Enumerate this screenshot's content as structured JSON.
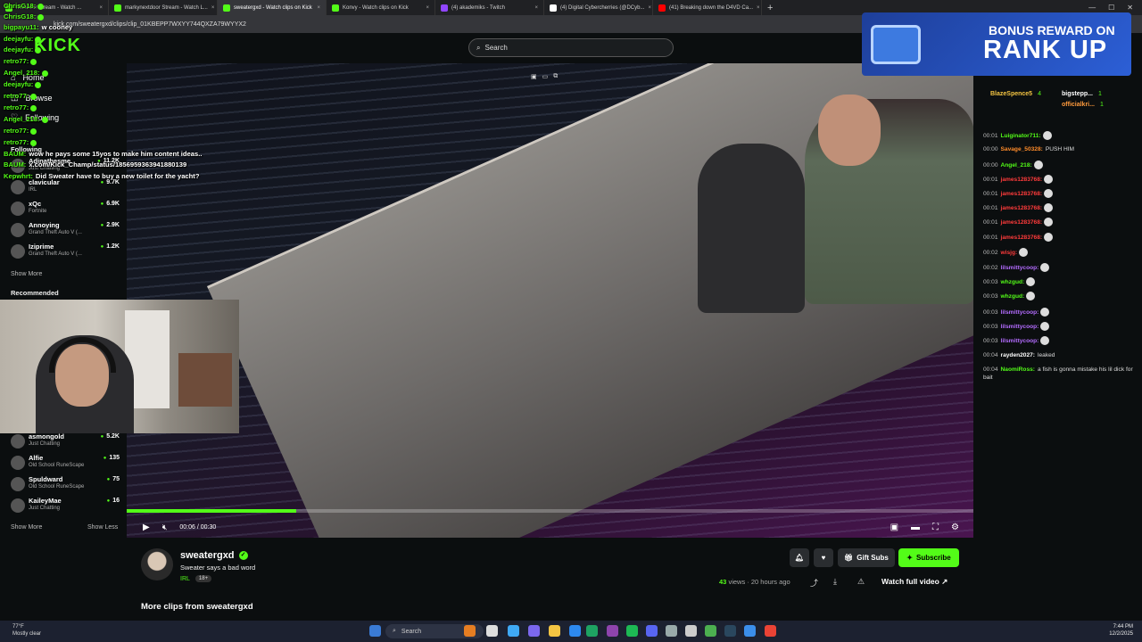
{
  "browser": {
    "tabs": [
      {
        "label": "nextdoor Stream - Watch ...",
        "color": "#53fc18",
        "active": false
      },
      {
        "label": "markynextdoor Stream - Watch L...",
        "color": "#53fc18",
        "active": false
      },
      {
        "label": "sweatergxd - Watch clips on Kick",
        "color": "#53fc18",
        "active": true
      },
      {
        "label": "Konvy - Watch clips on Kick",
        "color": "#53fc18",
        "active": false
      },
      {
        "label": "(4) akademiks - Twitch",
        "color": "#9146ff",
        "active": false
      },
      {
        "label": "(4) Digital Cybercherries (@DCyb...",
        "color": "#ffffff",
        "active": false
      },
      {
        "label": "(41) Breaking down the D4VD Ca...",
        "color": "#ff0000",
        "active": false
      }
    ],
    "url": "kick.com/sweatergxd/clips/clip_01KBEPP7WXYY744QXZA79WYYX2"
  },
  "kick": {
    "search_placeholder": "Search",
    "nav": {
      "home": "Home",
      "browse": "Browse",
      "following": "Following"
    },
    "sections": {
      "following": "Following",
      "recommended": "Recommended"
    },
    "following_channels": [
      {
        "name": "Adinathesme",
        "game": "Just Chatting",
        "viewers": "11.2K"
      },
      {
        "name": "clavicular",
        "game": "IRL",
        "viewers": "9.7K"
      },
      {
        "name": "xQc",
        "game": "Fortnite",
        "viewers": "6.9K"
      },
      {
        "name": "Annoying",
        "game": "Grand Theft Auto V (...",
        "viewers": "2.9K"
      },
      {
        "name": "Iziprime",
        "game": "Grand Theft Auto V (...",
        "viewers": "1.2K"
      }
    ],
    "recommended_channels": [
      {
        "name": "asmongold",
        "game": "Just Chatting",
        "viewers": "5.2K"
      },
      {
        "name": "Alfie",
        "game": "Old School RuneScape",
        "viewers": "135"
      },
      {
        "name": "Spuldward",
        "game": "Old School RuneScape",
        "viewers": "75"
      },
      {
        "name": "KaileyMae",
        "game": "Just Chatting",
        "viewers": "16"
      }
    ],
    "show_more": "Show More",
    "show_less": "Show Less"
  },
  "player": {
    "time": "00:06 / 00:30",
    "progress_fraction": 0.2
  },
  "clip": {
    "channel": "sweatergxd",
    "title": "Sweater says a bad word",
    "category": "IRL",
    "age_badge": "18+",
    "views": "43",
    "views_label": "views",
    "age": "20 hours ago",
    "gift_subs": "Gift Subs",
    "subscribe": "Subscribe",
    "watch_full": "Watch full video",
    "more_clips": "More clips from sweatergxd"
  },
  "promo": {
    "line1": "BONUS REWARD ON",
    "line2": "RANK UP"
  },
  "leaderboard": [
    {
      "name": "BlazeSpence5",
      "count": "4"
    },
    {
      "name": "bigstepp...",
      "count": "1"
    },
    {
      "name": "officialkri...",
      "count": "1"
    }
  ],
  "chat": [
    {
      "time": "00:01",
      "user": "Luiginator711:",
      "color": "#53fc18",
      "text": ""
    },
    {
      "time": "00:00",
      "user": "Savage_50328:",
      "color": "#ff8c2a",
      "text": "PUSH HIM"
    },
    {
      "time": "00:00",
      "user": "Angel_218:",
      "color": "#53fc18",
      "text": ""
    },
    {
      "time": "00:01",
      "user": "james1283768:",
      "color": "#ff3b3b",
      "text": ""
    },
    {
      "time": "00:01",
      "user": "james1283768:",
      "color": "#ff3b3b",
      "text": ""
    },
    {
      "time": "00:01",
      "user": "james1283768:",
      "color": "#ff3b3b",
      "text": ""
    },
    {
      "time": "00:01",
      "user": "james1283768:",
      "color": "#ff3b3b",
      "text": ""
    },
    {
      "time": "00:01",
      "user": "james1283768:",
      "color": "#ff3b3b",
      "text": ""
    },
    {
      "time": "00:02",
      "user": "wisjg:",
      "color": "#ff3b3b",
      "text": ""
    },
    {
      "time": "00:02",
      "user": "lilsmittycoop:",
      "color": "#b46cff",
      "text": ""
    },
    {
      "time": "00:03",
      "user": "whzgud:",
      "color": "#53fc18",
      "text": ""
    },
    {
      "time": "00:03",
      "user": "whzgud:",
      "color": "#53fc18",
      "text": ""
    },
    {
      "time": "00:03",
      "user": "lilsmittycoop:",
      "color": "#b46cff",
      "text": ""
    },
    {
      "time": "00:03",
      "user": "lilsmittycoop:",
      "color": "#b46cff",
      "text": ""
    },
    {
      "time": "00:03",
      "user": "lilsmittycoop:",
      "color": "#b46cff",
      "text": ""
    },
    {
      "time": "00:04",
      "user": "rayden2027:",
      "color": "#ffffff",
      "text": "leaked"
    },
    {
      "time": "00:04",
      "user": "NaomiRoss:",
      "color": "#53fc18",
      "text": "a fish is gonna mistake his lil dick for bait"
    }
  ],
  "overlay_chat": [
    {
      "user": "ChrisG18:",
      "text": ""
    },
    {
      "user": "ChrisG18:",
      "text": ""
    },
    {
      "user": "bigpayu11:",
      "text": "w cooney"
    },
    {
      "user": "deejayfu:",
      "text": ""
    },
    {
      "user": "deejayfu:",
      "text": ""
    },
    {
      "user": "retro77:",
      "text": ""
    },
    {
      "user": "Angel_218:",
      "text": ""
    },
    {
      "user": "deejayfu:",
      "text": ""
    },
    {
      "user": "retro77:",
      "text": ""
    },
    {
      "user": "retro77:",
      "text": ""
    },
    {
      "user": "Angel_218:",
      "text": ""
    },
    {
      "user": "retro77:",
      "text": ""
    },
    {
      "user": "retro77:",
      "text": ""
    },
    {
      "user": "BAUM:",
      "text": "wow he pays some 15yos to make him content ideas.."
    },
    {
      "user": "BAUM:",
      "text": "x.com/Kick_Champ/status/1856959363941880139"
    },
    {
      "user": "Kepwhrt:",
      "text": "Did Sweater have to buy a new toilet for the yacht?"
    }
  ],
  "taskbar": {
    "weather_temp": "77°F",
    "weather_desc": "Mostly clear",
    "search": "Search",
    "time": "7:44 PM",
    "date": "12/2/2025"
  }
}
